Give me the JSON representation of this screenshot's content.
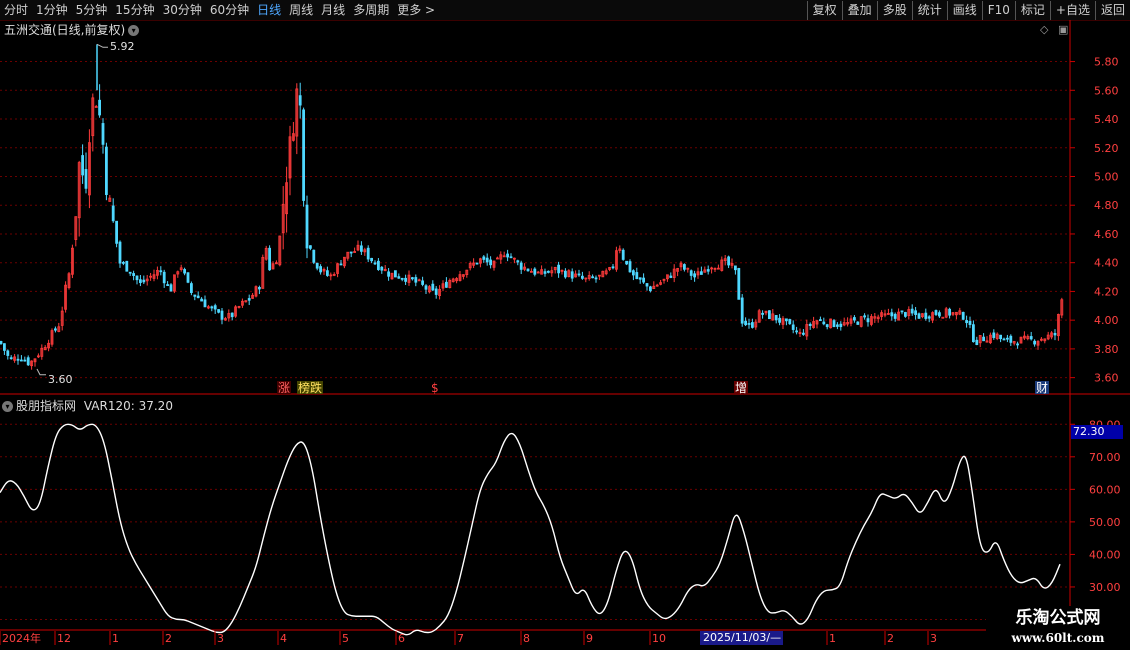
{
  "toolbar": {
    "periods": [
      "分时",
      "1分钟",
      "5分钟",
      "15分钟",
      "30分钟",
      "60分钟",
      "日线",
      "周线",
      "月线",
      "多周期",
      "更多 >"
    ],
    "active_period": "日线",
    "buttons": [
      "复权",
      "叠加",
      "多股",
      "统计",
      "画线",
      "F10",
      "标记",
      "+自选",
      "返回"
    ]
  },
  "main_chart": {
    "title": "五洲交通(日线,前复权)",
    "high_label": "5.92",
    "low_label": "3.60"
  },
  "indicator": {
    "title": "股朋指标网",
    "var_label": "VAR120: 37.20",
    "current_badge": "72.30"
  },
  "date_axis": {
    "labels": [
      "2024年",
      "12",
      "1",
      "2",
      "3",
      "4",
      "5",
      "6",
      "7",
      "8",
      "9",
      "10",
      "1",
      "2",
      "3"
    ],
    "highlight": "2025/11/03/—"
  },
  "watermark": {
    "line1": "乐淘公式网",
    "line2": "www.60lt.com"
  },
  "colors": {
    "up": "#ff3b3b",
    "down": "#4fd8ff",
    "line": "#ffffff",
    "grid": "#6b0000",
    "axis": "#cc0000"
  },
  "chart_data": [
    {
      "type": "candlestick",
      "title": "五洲交通(日线,前复权)",
      "ylim": [
        3.5,
        5.95
      ],
      "yticks": [
        3.6,
        3.8,
        4.0,
        4.2,
        4.4,
        4.6,
        4.8,
        5.0,
        5.2,
        5.4,
        5.6,
        5.8
      ],
      "ytick_labels": [
        "3.60",
        "3.80",
        "4.00",
        "4.20",
        "4.40",
        "4.60",
        "4.80",
        "5.00",
        "5.20",
        "5.40",
        "5.60",
        "5.80"
      ],
      "grid": true,
      "close_series": [
        [
          0,
          3.85
        ],
        [
          10,
          3.72
        ],
        [
          20,
          3.75
        ],
        [
          30,
          3.7
        ],
        [
          40,
          3.78
        ],
        [
          50,
          3.88
        ],
        [
          60,
          3.98
        ],
        [
          65,
          4.2
        ],
        [
          70,
          4.35
        ],
        [
          75,
          4.7
        ],
        [
          80,
          5.15
        ],
        [
          85,
          4.9
        ],
        [
          90,
          5.4
        ],
        [
          95,
          5.6
        ],
        [
          98,
          5.5
        ],
        [
          102,
          5.3
        ],
        [
          108,
          4.85
        ],
        [
          115,
          4.6
        ],
        [
          120,
          4.4
        ],
        [
          130,
          4.35
        ],
        [
          140,
          4.25
        ],
        [
          150,
          4.3
        ],
        [
          160,
          4.35
        ],
        [
          170,
          4.2
        ],
        [
          180,
          4.4
        ],
        [
          190,
          4.2
        ],
        [
          200,
          4.15
        ],
        [
          210,
          4.08
        ],
        [
          220,
          4.03
        ],
        [
          230,
          4.02
        ],
        [
          240,
          4.1
        ],
        [
          250,
          4.15
        ],
        [
          260,
          4.25
        ],
        [
          265,
          4.55
        ],
        [
          270,
          4.35
        ],
        [
          278,
          4.45
        ],
        [
          285,
          4.95
        ],
        [
          290,
          5.2
        ],
        [
          295,
          5.5
        ],
        [
          299,
          5.68
        ],
        [
          303,
          5.0
        ],
        [
          307,
          4.6
        ],
        [
          312,
          4.45
        ],
        [
          320,
          4.35
        ],
        [
          330,
          4.3
        ],
        [
          345,
          4.45
        ],
        [
          360,
          4.5
        ],
        [
          375,
          4.4
        ],
        [
          390,
          4.32
        ],
        [
          405,
          4.3
        ],
        [
          420,
          4.25
        ],
        [
          435,
          4.18
        ],
        [
          450,
          4.28
        ],
        [
          465,
          4.35
        ],
        [
          480,
          4.42
        ],
        [
          495,
          4.38
        ],
        [
          505,
          4.48
        ],
        [
          520,
          4.38
        ],
        [
          540,
          4.32
        ],
        [
          555,
          4.35
        ],
        [
          570,
          4.32
        ],
        [
          585,
          4.28
        ],
        [
          600,
          4.3
        ],
        [
          612,
          4.35
        ],
        [
          618,
          4.55
        ],
        [
          625,
          4.4
        ],
        [
          635,
          4.3
        ],
        [
          650,
          4.22
        ],
        [
          665,
          4.28
        ],
        [
          680,
          4.38
        ],
        [
          695,
          4.3
        ],
        [
          710,
          4.38
        ],
        [
          725,
          4.4
        ],
        [
          735,
          4.35
        ],
        [
          742,
          4.0
        ],
        [
          750,
          3.95
        ],
        [
          760,
          4.05
        ],
        [
          775,
          4.02
        ],
        [
          790,
          3.95
        ],
        [
          800,
          3.9
        ],
        [
          815,
          4.0
        ],
        [
          830,
          3.98
        ],
        [
          845,
          3.97
        ],
        [
          860,
          4.0
        ],
        [
          875,
          4.02
        ],
        [
          890,
          4.03
        ],
        [
          905,
          4.05
        ],
        [
          920,
          4.03
        ],
        [
          935,
          4.05
        ],
        [
          950,
          4.05
        ],
        [
          965,
          4.03
        ],
        [
          975,
          3.85
        ],
        [
          985,
          3.88
        ],
        [
          995,
          3.9
        ],
        [
          1005,
          3.85
        ],
        [
          1020,
          3.86
        ],
        [
          1035,
          3.86
        ],
        [
          1045,
          3.88
        ],
        [
          1055,
          3.9
        ],
        [
          1062,
          4.15
        ]
      ],
      "markers": [
        "涨",
        "榜跌",
        "$",
        "增",
        "财"
      ]
    },
    {
      "type": "line",
      "title": "股朋指标网",
      "series": [
        {
          "name": "VAR120",
          "last": 37.2
        }
      ],
      "ylim": [
        18,
        85
      ],
      "yticks": [
        20,
        30,
        40,
        50,
        60,
        70,
        80
      ],
      "ytick_labels": [
        "20.00",
        "30.00",
        "40.00",
        "50.00",
        "60.00",
        "70.00",
        "80.00"
      ],
      "grid": true,
      "points": [
        [
          0,
          59
        ],
        [
          8,
          63
        ],
        [
          16,
          62
        ],
        [
          24,
          58
        ],
        [
          32,
          53
        ],
        [
          40,
          55
        ],
        [
          48,
          67
        ],
        [
          56,
          77
        ],
        [
          64,
          80
        ],
        [
          72,
          80
        ],
        [
          80,
          78
        ],
        [
          88,
          80
        ],
        [
          96,
          80
        ],
        [
          104,
          75
        ],
        [
          112,
          63
        ],
        [
          120,
          50
        ],
        [
          128,
          42
        ],
        [
          136,
          37
        ],
        [
          144,
          33
        ],
        [
          152,
          29
        ],
        [
          160,
          25
        ],
        [
          168,
          21
        ],
        [
          176,
          20
        ],
        [
          184,
          20
        ],
        [
          192,
          19
        ],
        [
          200,
          18
        ],
        [
          208,
          17
        ],
        [
          216,
          16
        ],
        [
          224,
          16
        ],
        [
          232,
          19
        ],
        [
          240,
          24
        ],
        [
          248,
          30
        ],
        [
          256,
          36
        ],
        [
          264,
          46
        ],
        [
          272,
          55
        ],
        [
          280,
          62
        ],
        [
          288,
          69
        ],
        [
          296,
          74
        ],
        [
          304,
          75
        ],
        [
          312,
          67
        ],
        [
          320,
          52
        ],
        [
          328,
          39
        ],
        [
          336,
          28
        ],
        [
          344,
          22
        ],
        [
          352,
          21
        ],
        [
          360,
          21
        ],
        [
          368,
          21
        ],
        [
          376,
          21
        ],
        [
          384,
          19
        ],
        [
          392,
          17
        ],
        [
          400,
          16
        ],
        [
          408,
          15
        ],
        [
          416,
          17
        ],
        [
          424,
          16
        ],
        [
          432,
          16
        ],
        [
          440,
          18
        ],
        [
          448,
          21
        ],
        [
          456,
          28
        ],
        [
          464,
          38
        ],
        [
          472,
          49
        ],
        [
          480,
          60
        ],
        [
          488,
          65
        ],
        [
          496,
          68
        ],
        [
          504,
          75
        ],
        [
          512,
          78
        ],
        [
          520,
          74
        ],
        [
          528,
          66
        ],
        [
          536,
          59
        ],
        [
          544,
          55
        ],
        [
          552,
          49
        ],
        [
          560,
          39
        ],
        [
          568,
          33
        ],
        [
          576,
          27
        ],
        [
          584,
          30
        ],
        [
          592,
          24
        ],
        [
          600,
          21
        ],
        [
          608,
          25
        ],
        [
          616,
          35
        ],
        [
          624,
          42
        ],
        [
          632,
          39
        ],
        [
          640,
          29
        ],
        [
          648,
          24
        ],
        [
          656,
          22
        ],
        [
          664,
          20
        ],
        [
          672,
          21
        ],
        [
          680,
          24
        ],
        [
          688,
          29
        ],
        [
          696,
          31
        ],
        [
          704,
          30
        ],
        [
          712,
          33
        ],
        [
          720,
          37
        ],
        [
          728,
          45
        ],
        [
          736,
          54
        ],
        [
          744,
          47
        ],
        [
          752,
          37
        ],
        [
          760,
          27
        ],
        [
          768,
          22
        ],
        [
          776,
          22
        ],
        [
          784,
          23
        ],
        [
          792,
          21
        ],
        [
          800,
          18
        ],
        [
          808,
          20
        ],
        [
          816,
          26
        ],
        [
          824,
          29
        ],
        [
          832,
          29
        ],
        [
          840,
          30
        ],
        [
          848,
          38
        ],
        [
          856,
          44
        ],
        [
          864,
          49
        ],
        [
          872,
          53
        ],
        [
          880,
          59
        ],
        [
          888,
          58
        ],
        [
          896,
          57
        ],
        [
          904,
          59
        ],
        [
          912,
          56
        ],
        [
          920,
          52
        ],
        [
          928,
          56
        ],
        [
          936,
          61
        ],
        [
          944,
          55
        ],
        [
          952,
          60
        ],
        [
          960,
          69
        ],
        [
          966,
          71
        ],
        [
          972,
          60
        ],
        [
          980,
          42
        ],
        [
          988,
          40
        ],
        [
          996,
          45
        ],
        [
          1004,
          38
        ],
        [
          1012,
          33
        ],
        [
          1020,
          31
        ],
        [
          1028,
          32
        ],
        [
          1036,
          33
        ],
        [
          1044,
          29
        ],
        [
          1052,
          31
        ],
        [
          1060,
          37
        ]
      ]
    }
  ]
}
